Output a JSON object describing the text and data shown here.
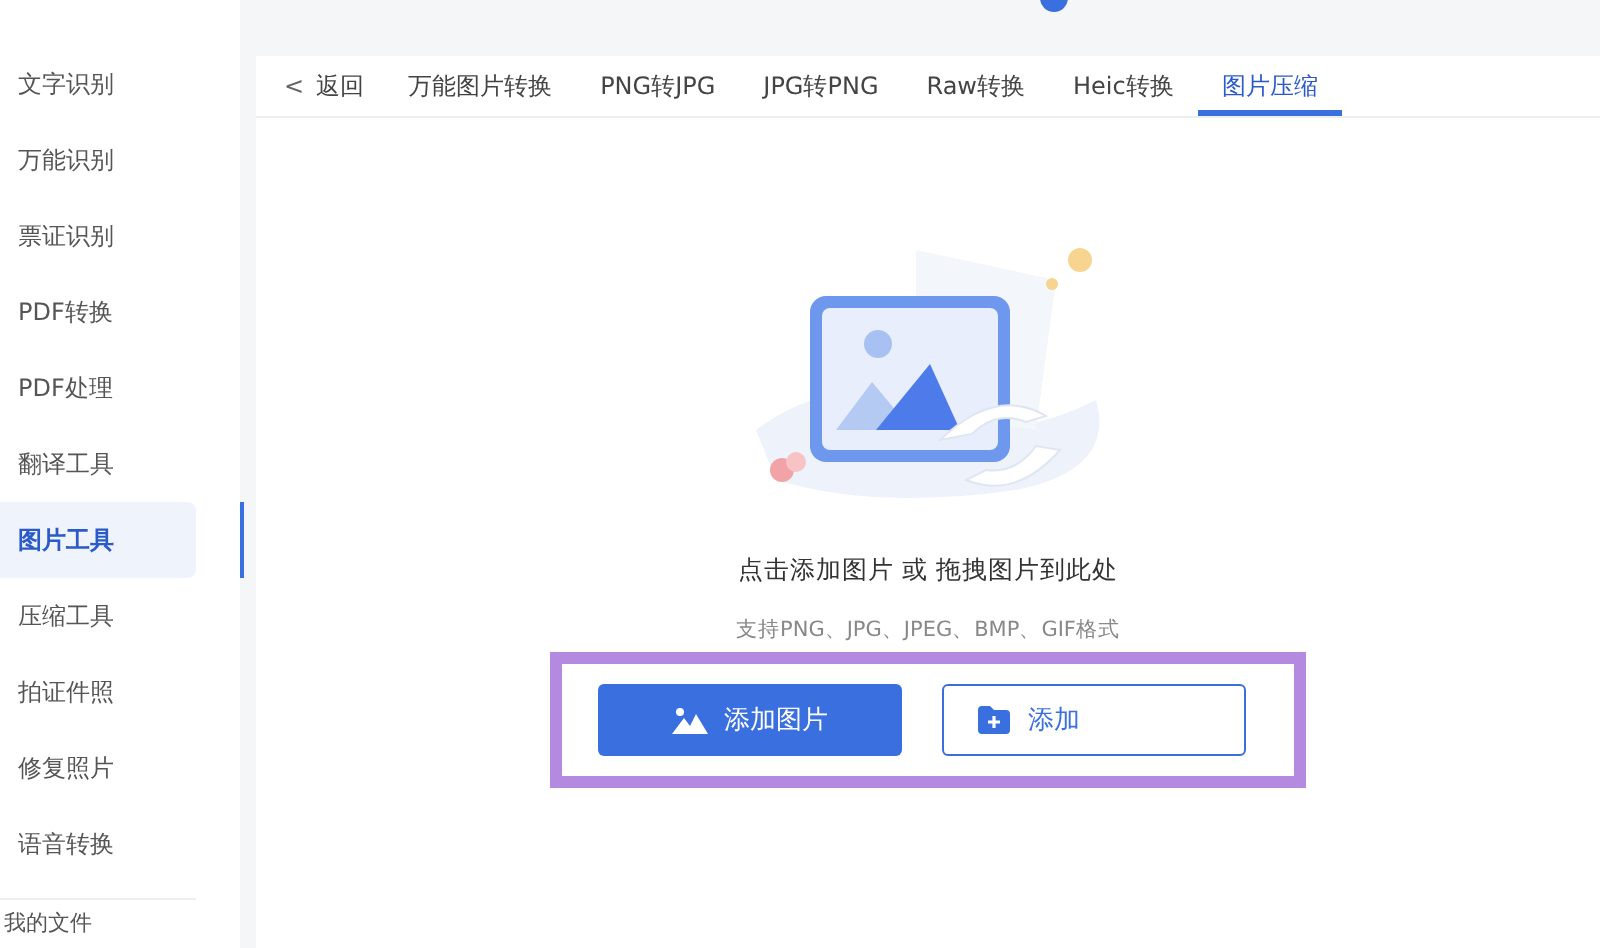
{
  "sidebar": {
    "items": [
      {
        "label": "文字识别",
        "selected": false
      },
      {
        "label": "万能识别",
        "selected": false
      },
      {
        "label": "票证识别",
        "selected": false
      },
      {
        "label": "PDF转换",
        "selected": false
      },
      {
        "label": "PDF处理",
        "selected": false
      },
      {
        "label": "翻译工具",
        "selected": false
      },
      {
        "label": "图片工具",
        "selected": true
      },
      {
        "label": "压缩工具",
        "selected": false
      },
      {
        "label": "拍证件照",
        "selected": false
      },
      {
        "label": "修复照片",
        "selected": false
      },
      {
        "label": "语音转换",
        "selected": false
      }
    ],
    "footer": "我的文件"
  },
  "back": {
    "icon": "<",
    "label": "返回"
  },
  "tabs": [
    {
      "label": "万能图片转换",
      "selected": false
    },
    {
      "label": "PNG转JPG",
      "selected": false
    },
    {
      "label": "JPG转PNG",
      "selected": false
    },
    {
      "label": "Raw转换",
      "selected": false
    },
    {
      "label": "Heic转换",
      "selected": false
    },
    {
      "label": "图片压缩",
      "selected": true
    }
  ],
  "upload": {
    "prompt": "点击添加图片 或 拖拽图片到此处",
    "formats": "支持PNG、JPG、JPEG、BMP、GIF格式",
    "buttons": [
      {
        "kind": "primary",
        "label": "添加图片"
      },
      {
        "kind": "secondary",
        "label": "添加"
      }
    ]
  }
}
